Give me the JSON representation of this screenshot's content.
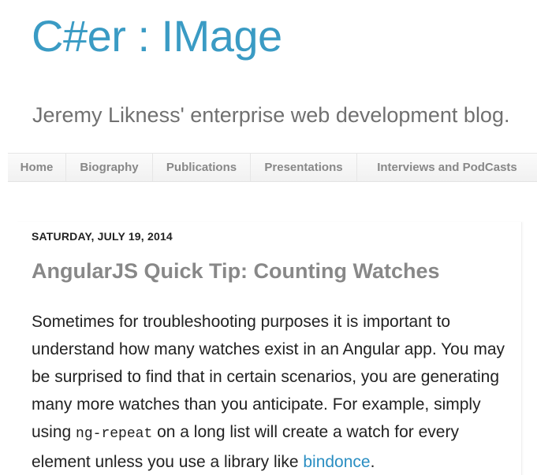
{
  "header": {
    "title": "C#er : IMage",
    "description": "Jeremy Likness' enterprise web development blog."
  },
  "nav": {
    "tabs": [
      {
        "label": "Home"
      },
      {
        "label": "Biography"
      },
      {
        "label": "Publications"
      },
      {
        "label": "Presentations"
      },
      {
        "label": "Interviews and PodCasts"
      }
    ]
  },
  "post": {
    "date": "SATURDAY, JULY 19, 2014",
    "title": "AngularJS Quick Tip: Counting Watches",
    "body": {
      "text_1": "Sometimes for troubleshooting purposes it is important to understand how many watches exist in an Angular app. You may be surprised to find that in certain scenarios, you are generating many more watches than you anticipate. For example, simply using ",
      "code": "ng-repeat",
      "text_2": " on a long list will create a watch for every element unless you use a library like ",
      "link": "bindonce",
      "text_3": "."
    }
  },
  "colors": {
    "title": "#3a9bc4",
    "description": "#707070",
    "tab_text": "#888888",
    "post_title": "#888888",
    "link": "#2a8ec2"
  }
}
